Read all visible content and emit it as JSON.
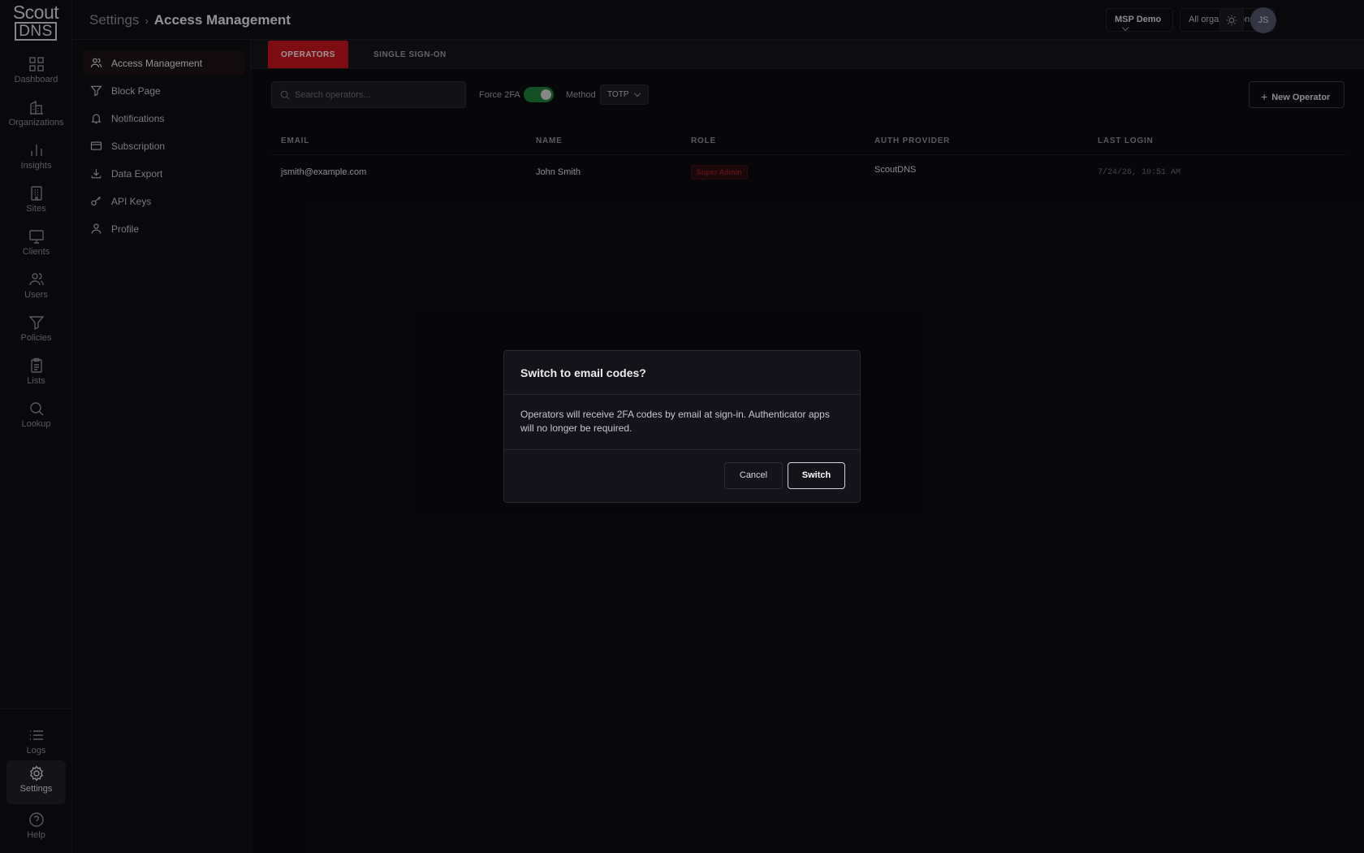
{
  "brand": {
    "line1": "Scout",
    "line2": "DNS"
  },
  "rail": {
    "items": [
      {
        "label": "Dashboard",
        "icon": "grid-icon"
      },
      {
        "label": "Organizations",
        "icon": "building-icon"
      },
      {
        "label": "Insights",
        "icon": "bar-chart-icon"
      },
      {
        "label": "Sites",
        "icon": "office-icon"
      },
      {
        "label": "Clients",
        "icon": "monitor-icon"
      },
      {
        "label": "Users",
        "icon": "users-icon"
      },
      {
        "label": "Policies",
        "icon": "filter-icon"
      },
      {
        "label": "Lists",
        "icon": "clipboard-icon"
      },
      {
        "label": "Lookup",
        "icon": "search-icon"
      }
    ],
    "bottom": [
      {
        "label": "Logs",
        "icon": "list-icon"
      },
      {
        "label": "Settings",
        "icon": "gear-icon",
        "active": true
      },
      {
        "label": "Help",
        "icon": "help-icon"
      }
    ]
  },
  "header": {
    "breadcrumb_root": "Settings",
    "breadcrumb_sep": "›",
    "breadcrumb_current": "Access Management",
    "tenant": "MSP Demo",
    "org_filter": "All organizations",
    "avatar_initials": "JS"
  },
  "settings_nav": [
    {
      "label": "Access Management",
      "icon": "users-icon",
      "active": true
    },
    {
      "label": "Block Page",
      "icon": "filter-icon"
    },
    {
      "label": "Notifications",
      "icon": "bell-icon"
    },
    {
      "label": "Subscription",
      "icon": "credit-card-icon"
    },
    {
      "label": "Data Export",
      "icon": "download-icon"
    },
    {
      "label": "API Keys",
      "icon": "key-icon"
    },
    {
      "label": "Profile",
      "icon": "user-icon"
    }
  ],
  "tabs": [
    {
      "label": "OPERATORS",
      "active": true
    },
    {
      "label": "SINGLE SIGN-ON",
      "active": false
    }
  ],
  "toolbar": {
    "search_placeholder": "Search operators...",
    "force_2fa_label": "Force 2FA",
    "force_2fa_on": true,
    "method_label": "Method",
    "method_value": "TOTP",
    "new_operator_label": "New Operator"
  },
  "table": {
    "columns": [
      "EMAIL",
      "NAME",
      "ROLE",
      "AUTH PROVIDER",
      "LAST LOGIN"
    ],
    "rows": [
      {
        "email": "jsmith@example.com",
        "name": "John Smith",
        "role": "Super Admin",
        "auth_provider": "ScoutDNS",
        "last_login": "7/24/26, 10:51 AM"
      }
    ]
  },
  "modal": {
    "title": "Switch to email codes?",
    "body": "Operators will receive 2FA codes by email at sign-in. Authenticator apps will no longer be required.",
    "cancel_label": "Cancel",
    "confirm_label": "Switch"
  },
  "colors": {
    "accent": "#c0141e",
    "toggle_on": "#1f7a3a",
    "background": "#0c0b10"
  }
}
